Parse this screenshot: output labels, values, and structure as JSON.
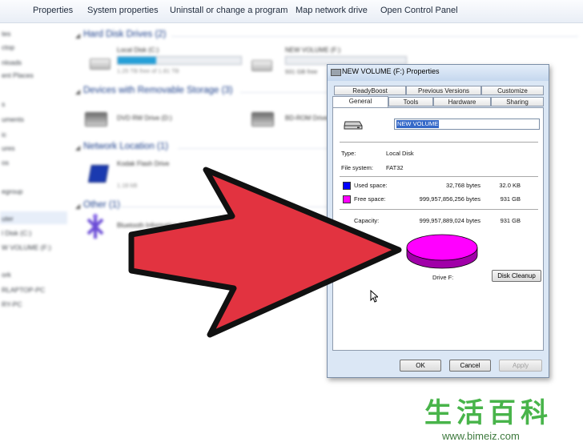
{
  "toolbar": {
    "items": [
      "Properties",
      "System properties",
      "Uninstall or change a program",
      "Map network drive",
      "Open Control Panel"
    ]
  },
  "nav": {
    "items": [
      "tes",
      "ctop",
      "nloads",
      "ent Places",
      "s",
      "uments",
      "ic",
      "ures",
      "os",
      "egroup",
      "uter",
      "l Disk (C:)",
      "W VOLUME (F:)",
      "ork",
      "RLAPTOP-PC",
      "RY-PC"
    ]
  },
  "groups": {
    "hard_disk": "Hard Disk Drives (2)",
    "removable": "Devices with Removable Storage (3)",
    "network": "Network Location (1)",
    "other": "Other (1)"
  },
  "items": {
    "local_disk": {
      "name": "Local Disk (C:)",
      "sub": "1.25 TB free of 1.81 TB",
      "used_fraction": 0.31
    },
    "new_volume": {
      "name": "NEW VOLUME (F:)",
      "sub": "931 GB free"
    },
    "dvd": {
      "name": "DVD RW Drive (D:)"
    },
    "bdrom": {
      "name": "BD-ROM Drive (E:)"
    },
    "kodak": {
      "name": "Kodak Flash Drive",
      "sub": "1.18 kB"
    },
    "bluetooth": {
      "name": "Bluetooth Information Exchange"
    }
  },
  "dialog": {
    "title": "NEW VOLUME (F:) Properties",
    "tabs_row1": [
      "ReadyBoost",
      "Previous Versions",
      "Customize"
    ],
    "tabs_row2": [
      "General",
      "Tools",
      "Hardware",
      "Sharing"
    ],
    "volume_name": "NEW VOLUME",
    "type_label": "Type:",
    "type_value": "Local Disk",
    "fs_label": "File system:",
    "fs_value": "FAT32",
    "used_label": "Used space:",
    "used_bytes": "32,768 bytes",
    "used_size": "32.0 KB",
    "free_label": "Free space:",
    "free_bytes": "999,957,856,256 bytes",
    "free_size": "931 GB",
    "capacity_label": "Capacity:",
    "capacity_bytes": "999,957,889,024 bytes",
    "capacity_size": "931 GB",
    "drive_label": "Drive F:",
    "cleanup_button": "Disk Cleanup",
    "ok_button": "OK",
    "cancel_button": "Cancel",
    "apply_button": "Apply",
    "used_color": "#0000ff",
    "free_color": "#ff00ff"
  },
  "watermark": {
    "chars": [
      "生",
      "活",
      "百",
      "科"
    ],
    "url": "www.bimeiz.com"
  },
  "overlay": {
    "arrow_color": "#e23340"
  }
}
